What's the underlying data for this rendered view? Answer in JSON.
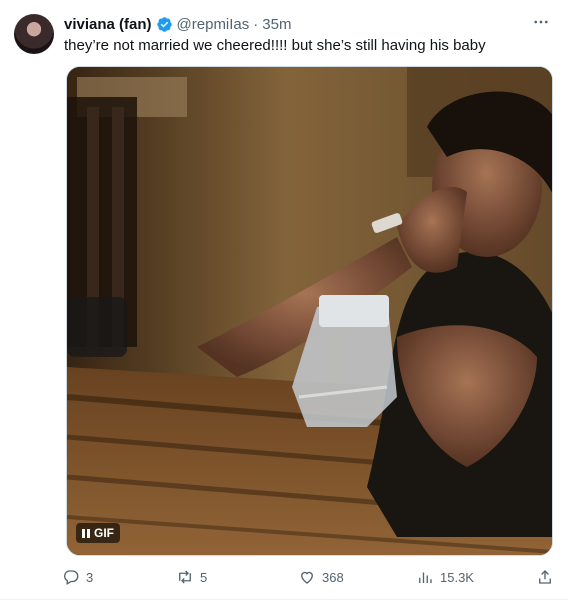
{
  "tweet": {
    "author_name": "viviana (fan)",
    "handle": "@repmiIas",
    "separator": "·",
    "time": "35m",
    "text": "they’re not married we cheered!!!! but she’s still having his baby",
    "media": {
      "type": "gif",
      "badge_label": "GIF"
    },
    "metrics": {
      "replies": "3",
      "retweets": "5",
      "likes": "368",
      "views": "15.3K"
    }
  },
  "colors": {
    "verified": "#1d9bf0",
    "muted": "#536471",
    "text": "#0f1419"
  },
  "icons": {
    "more": "more-horizontal-icon",
    "reply": "reply-icon",
    "retweet": "retweet-icon",
    "like": "heart-icon",
    "views": "analytics-icon",
    "share": "share-icon",
    "verified": "verified-badge-icon",
    "pause": "pause-icon"
  }
}
